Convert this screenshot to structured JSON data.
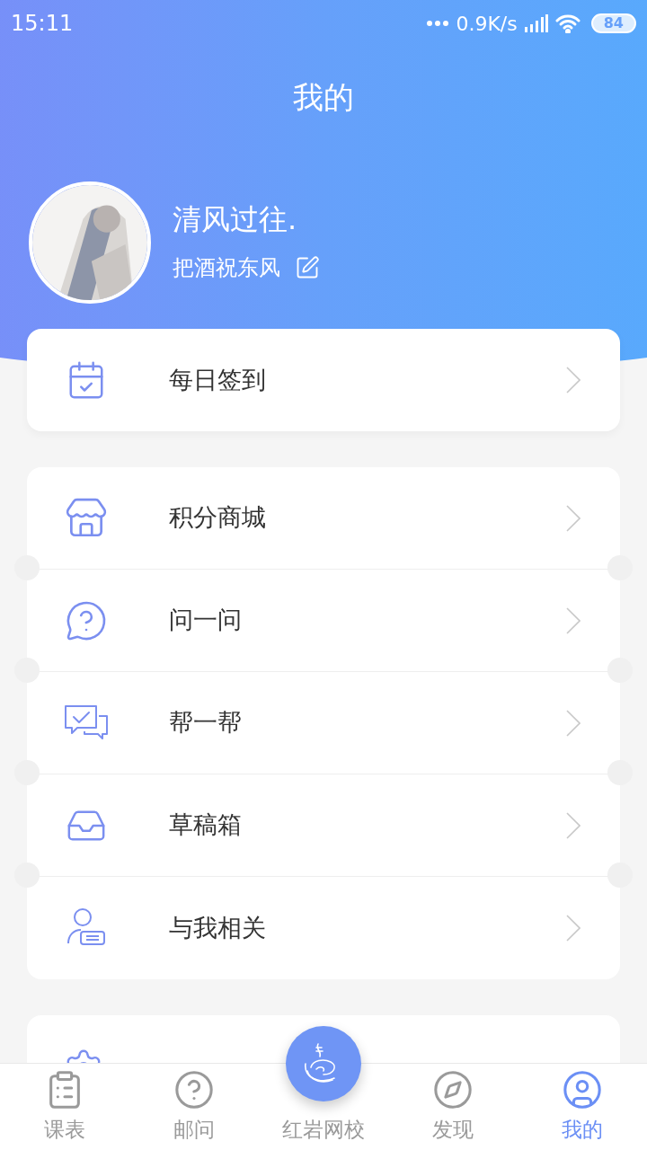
{
  "status_bar": {
    "time": "15:11",
    "network_speed": "0.9K/s",
    "battery": "84"
  },
  "title": "我的",
  "profile": {
    "name": "清风过往.",
    "signature": "把酒祝东风"
  },
  "daily": {
    "label": "每日签到",
    "kind": "calendar"
  },
  "menu": [
    {
      "label": "积分商城",
      "kind": "store"
    },
    {
      "label": "问一问",
      "kind": "ask"
    },
    {
      "label": "帮一帮",
      "kind": "help"
    },
    {
      "label": "草稿箱",
      "kind": "drafts"
    },
    {
      "label": "与我相关",
      "kind": "related"
    }
  ],
  "settings": {
    "kind": "settings"
  },
  "nav": [
    {
      "label": "课表",
      "kind": "schedule",
      "selected": false
    },
    {
      "label": "邮问",
      "kind": "question",
      "selected": false
    },
    {
      "label": "红岩网校",
      "kind": "center",
      "selected": false
    },
    {
      "label": "发现",
      "kind": "discover",
      "selected": false
    },
    {
      "label": "我的",
      "kind": "me",
      "selected": true
    }
  ]
}
